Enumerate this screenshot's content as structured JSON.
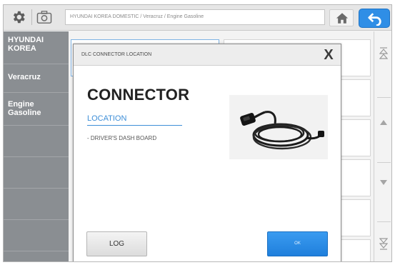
{
  "toolbar": {
    "path": "HYUNDAI KOREA DOMESTIC / Veracruz / Engine Gasoline",
    "settings_icon": "gear-icon",
    "capture_icon": "camera-icon",
    "home_icon": "home-icon",
    "back_icon": "back-arrow-icon"
  },
  "sidebar": {
    "items": [
      {
        "label": "HYUNDAI\nKOREA"
      },
      {
        "label": "Veracruz"
      },
      {
        "label": "Engine\nGasoline"
      }
    ]
  },
  "dialog": {
    "title": "DLC CONNECTOR LOCATION",
    "close_label": "X",
    "heading": "CONNECTOR",
    "location_label": "LOCATION",
    "location_text": "- DRIVER'S DASH BOARD",
    "image": "obd-cable-image",
    "log_button": "LOG",
    "ok_button": "OK"
  },
  "scroll": {
    "icons": [
      "page-up-icon",
      "up-icon",
      "down-icon",
      "page-down-icon"
    ]
  },
  "colors": {
    "accent_blue": "#2f8ee6",
    "sidebar_gray": "#8a8e92",
    "location_blue": "#3f8fd8"
  }
}
